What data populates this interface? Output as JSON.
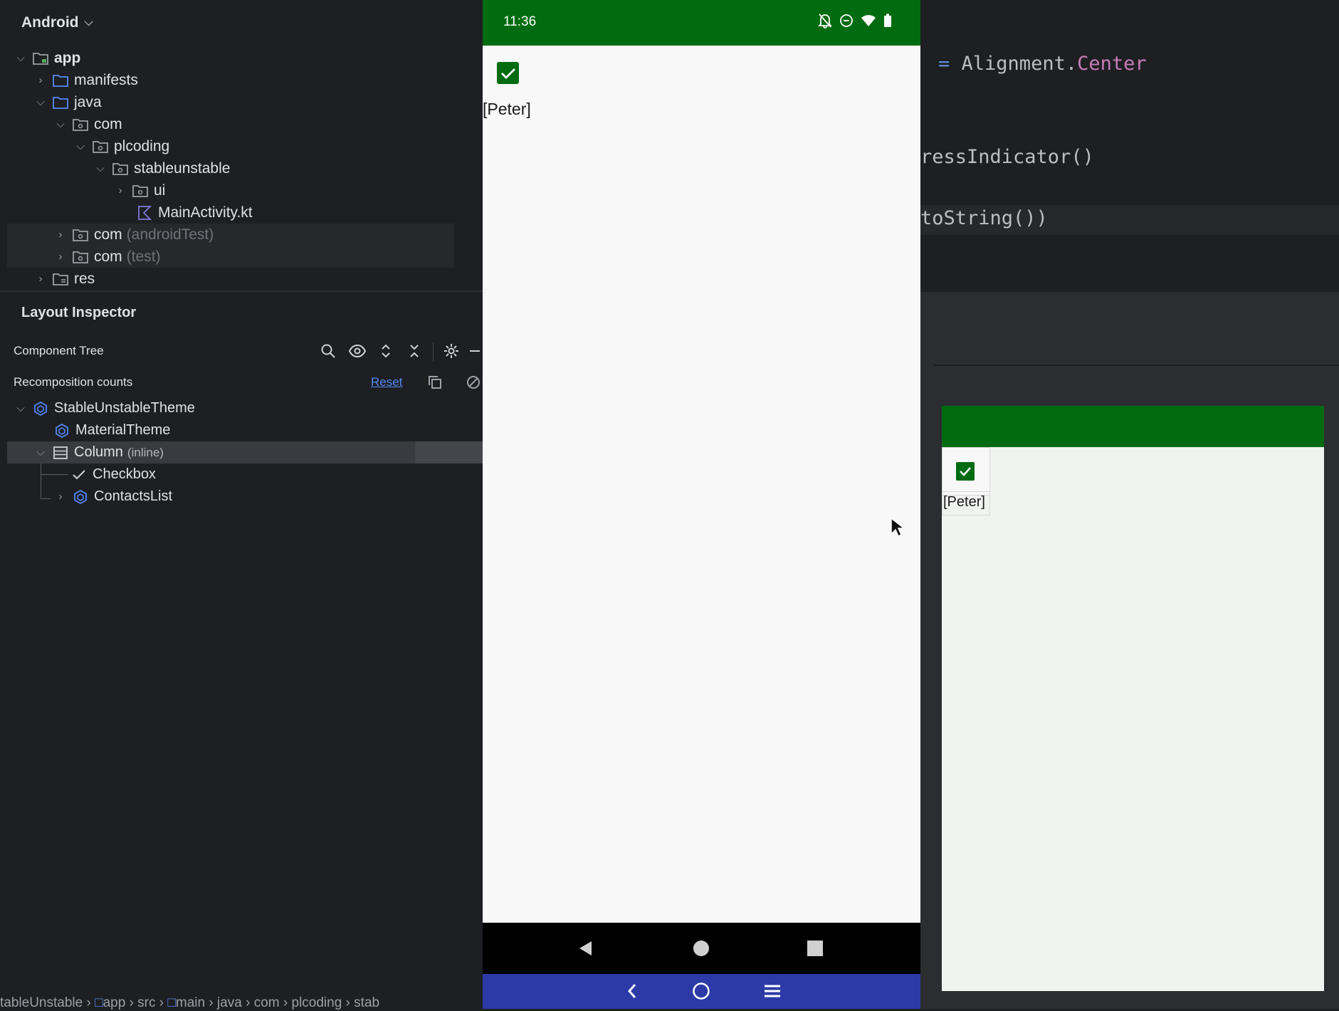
{
  "project": {
    "view_label": "Android",
    "tree": [
      {
        "name": "app",
        "note": ""
      },
      {
        "name": "manifests",
        "note": ""
      },
      {
        "name": "java",
        "note": ""
      },
      {
        "name": "com",
        "note": ""
      },
      {
        "name": "plcoding",
        "note": ""
      },
      {
        "name": "stableunstable",
        "note": ""
      },
      {
        "name": "ui",
        "note": ""
      },
      {
        "name": "MainActivity.kt",
        "note": ""
      },
      {
        "name": "com",
        "note": "(androidTest)"
      },
      {
        "name": "com",
        "note": "(test)"
      },
      {
        "name": "res",
        "note": ""
      }
    ]
  },
  "layout_inspector": {
    "title": "Layout Inspector",
    "component_tree_label": "Component Tree",
    "recomposition_label": "Recomposition counts",
    "reset_label": "Reset",
    "components": [
      {
        "name": "StableUnstableTheme",
        "note": ""
      },
      {
        "name": "MaterialTheme",
        "note": ""
      },
      {
        "name": "Column",
        "note": "(inline)"
      },
      {
        "name": "Checkbox",
        "note": ""
      },
      {
        "name": "ContactsList",
        "note": ""
      }
    ]
  },
  "breadcrumb": [
    "tableUnstable",
    "app",
    "src",
    "main",
    "java",
    "com",
    "plcoding",
    "stab"
  ],
  "phone": {
    "time": "11:36",
    "content_text": "[Peter]",
    "checkbox_checked": true
  },
  "editor": {
    "line1_op": "=",
    "line1_obj": "Alignment.",
    "line1_prop": "Center",
    "line2": "ressIndicator()",
    "line3": "toString())"
  },
  "preview": {
    "content_text": "[Peter]"
  },
  "colors": {
    "app_bar_green": "#006b10",
    "host_nav_blue": "#2c3aa8",
    "link_blue": "#548af7"
  }
}
